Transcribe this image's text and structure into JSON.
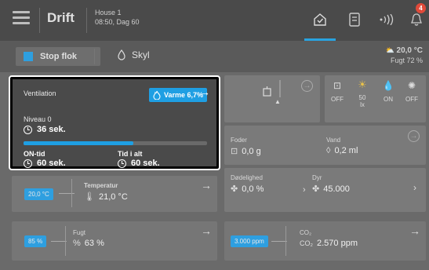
{
  "header": {
    "title": "Drift",
    "house_name": "House 1",
    "house_time": "08:50, Dag 60",
    "notification_count": "4"
  },
  "status": {
    "stop_flok_label": "Stop flok",
    "skyl_label": "Skyl",
    "outdoor_temp": "20,0 °C",
    "outdoor_humidity": "Fugt 72 %"
  },
  "ventilation": {
    "title": "Ventilation",
    "heat_badge": "Varme 6,7%",
    "level": "Niveau 0",
    "level_time": "36 sek.",
    "progress": 0.6,
    "on_time_label": "ON-tid",
    "on_time_value": "60 sek.",
    "total_time_label": "Tid i alt",
    "total_time_value": "60 sek."
  },
  "temperature": {
    "setpoint": "20,0 °C",
    "label": "Temperatur",
    "value": "21,0 °C"
  },
  "humidity": {
    "setpoint": "85 %",
    "label": "Fugt",
    "value": "63 %"
  },
  "co2": {
    "setpoint": "3.000 ppm",
    "label": "CO₂",
    "unit_label": "CO₂",
    "value": "2.570 ppm"
  },
  "lights": {
    "btn1": "OFF",
    "btn2_value": "50",
    "btn2_unit": "lx",
    "btn3": "ON",
    "btn4": "OFF"
  },
  "feed": {
    "foder_label": "Foder",
    "foder_value": "0,0 g",
    "vand_label": "Vand",
    "vand_value": "0,2 ml"
  },
  "mortality": {
    "label": "Dødelighed",
    "value": "0,0 %",
    "dyr_label": "Dyr",
    "dyr_value": "45.000"
  },
  "colors": {
    "accent": "#1f9fe3",
    "badge": "#e04a3a"
  }
}
